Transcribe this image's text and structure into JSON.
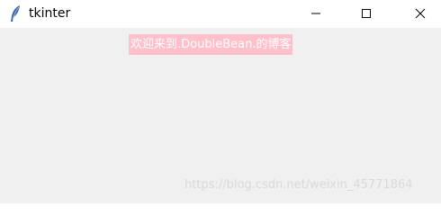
{
  "window": {
    "title": "tkinter",
    "app_icon": "feather-icon",
    "controls": {
      "minimize_icon": "minimize-icon",
      "maximize_icon": "maximize-icon",
      "close_icon": "close-icon"
    }
  },
  "content": {
    "label_text": "欢迎来到.DoubleBean.的博客",
    "label_bg": "#ffc0cb",
    "label_fg": "#ffffff",
    "background": "#f0f0f0"
  },
  "watermark": {
    "text": "https://blog.csdn.net/weixin_45771864"
  }
}
